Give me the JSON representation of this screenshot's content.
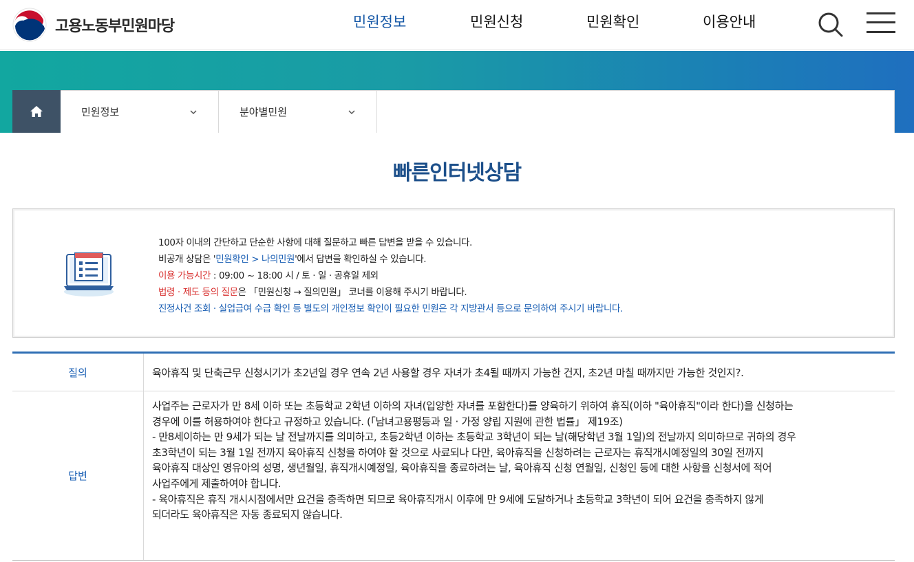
{
  "header": {
    "logo_text": "고용노동부민원마당",
    "nav": [
      "민원정보",
      "민원신청",
      "민원확인",
      "이용안내"
    ],
    "active_nav": "민원정보",
    "brand_colors": {
      "red": "#c8102e",
      "blue": "#003478"
    }
  },
  "breadcrumb": {
    "home_icon": "home-icon",
    "items": [
      "민원정보",
      "분야별민원"
    ]
  },
  "page": {
    "title": "빠른인터넷상담"
  },
  "info": {
    "line1": "100자 이내의 간단하고 단순한 사항에 대해 질문하고 빠른 답변을 받을 수 있습니다.",
    "line2_pre": "비공개 상담은 '",
    "line2_link": "민원확인 > 나의민원",
    "line2_post": "'에서 답변을 확인하실 수 있습니다.",
    "line3_label": "이용 가능시간",
    "line3_value": " : 09:00 ~ 18:00 시 / 토 · 일 · 공휴일 제외",
    "line4_label": "법령 · 제도 등의 질문",
    "line4_value": "은 「민원신청 → 질의민원」 코너를 이용해 주시기 바랍니다.",
    "line5": "진정사건 조회 · 실업급여 수급 확인 등 별도의 개인정보 확인이 필요한 민원은 각 지방관서 등으로 문의하여 주시기 바랍니다."
  },
  "qa": {
    "question_label": "질의",
    "question": "육아휴직 및 단축근무 신청시기가 초2년일 경우 연속 2년 사용할 경우 자녀가 초4될 때까지 가능한 건지, 초2년 마칠 때까지만 가능한 것인지?.",
    "answer_label": "답변",
    "answer_lines": [
      "사업주는 근로자가 만 8세 이하 또는 초등학교 2학년 이하의 자녀(입양한 자녀를 포함한다)를 양육하기 위하여 휴직(이하 \"육아휴직\"이라 한다)을 신청하는",
      "경우에 이를 허용하여야 한다고 규정하고 있습니다. (「남녀고용평등과 일 · 가정 양립 지원에 관한 법률」 제19조)",
      "- 만8세이하는 만 9세가 되는 날 전날까지를 의미하고, 초등2학년 이하는 초등학교 3학년이 되는 날(해당학년 3월 1일)의 전날까지 의미하므로 귀하의 경우",
      "초3학년이 되는 3월 1일 전까지 육아휴직 신청을 하여야 할 것으로 사료되나 다만, 육아휴직을 신청하려는 근로자는 휴직개시예정일의 30일 전까지",
      "육아휴직 대상인 영유아의 성명, 생년월일, 휴직개시예정일, 육아휴직을 종료하려는 날, 육아휴직 신청 연월일, 신청인 등에 대한 사항을 신청서에 적어",
      "사업주에게 제출하여야 합니다.",
      "- 육아휴직은 휴직 개시시점에서만 요건을 충족하면 되므로 육아휴직개시 이후에 만 9세에 도달하거나 초등학교 3학년이 되어 요건을 충족하지 않게",
      "되더라도 육아휴직은 자동 종료되지 않습니다."
    ]
  }
}
